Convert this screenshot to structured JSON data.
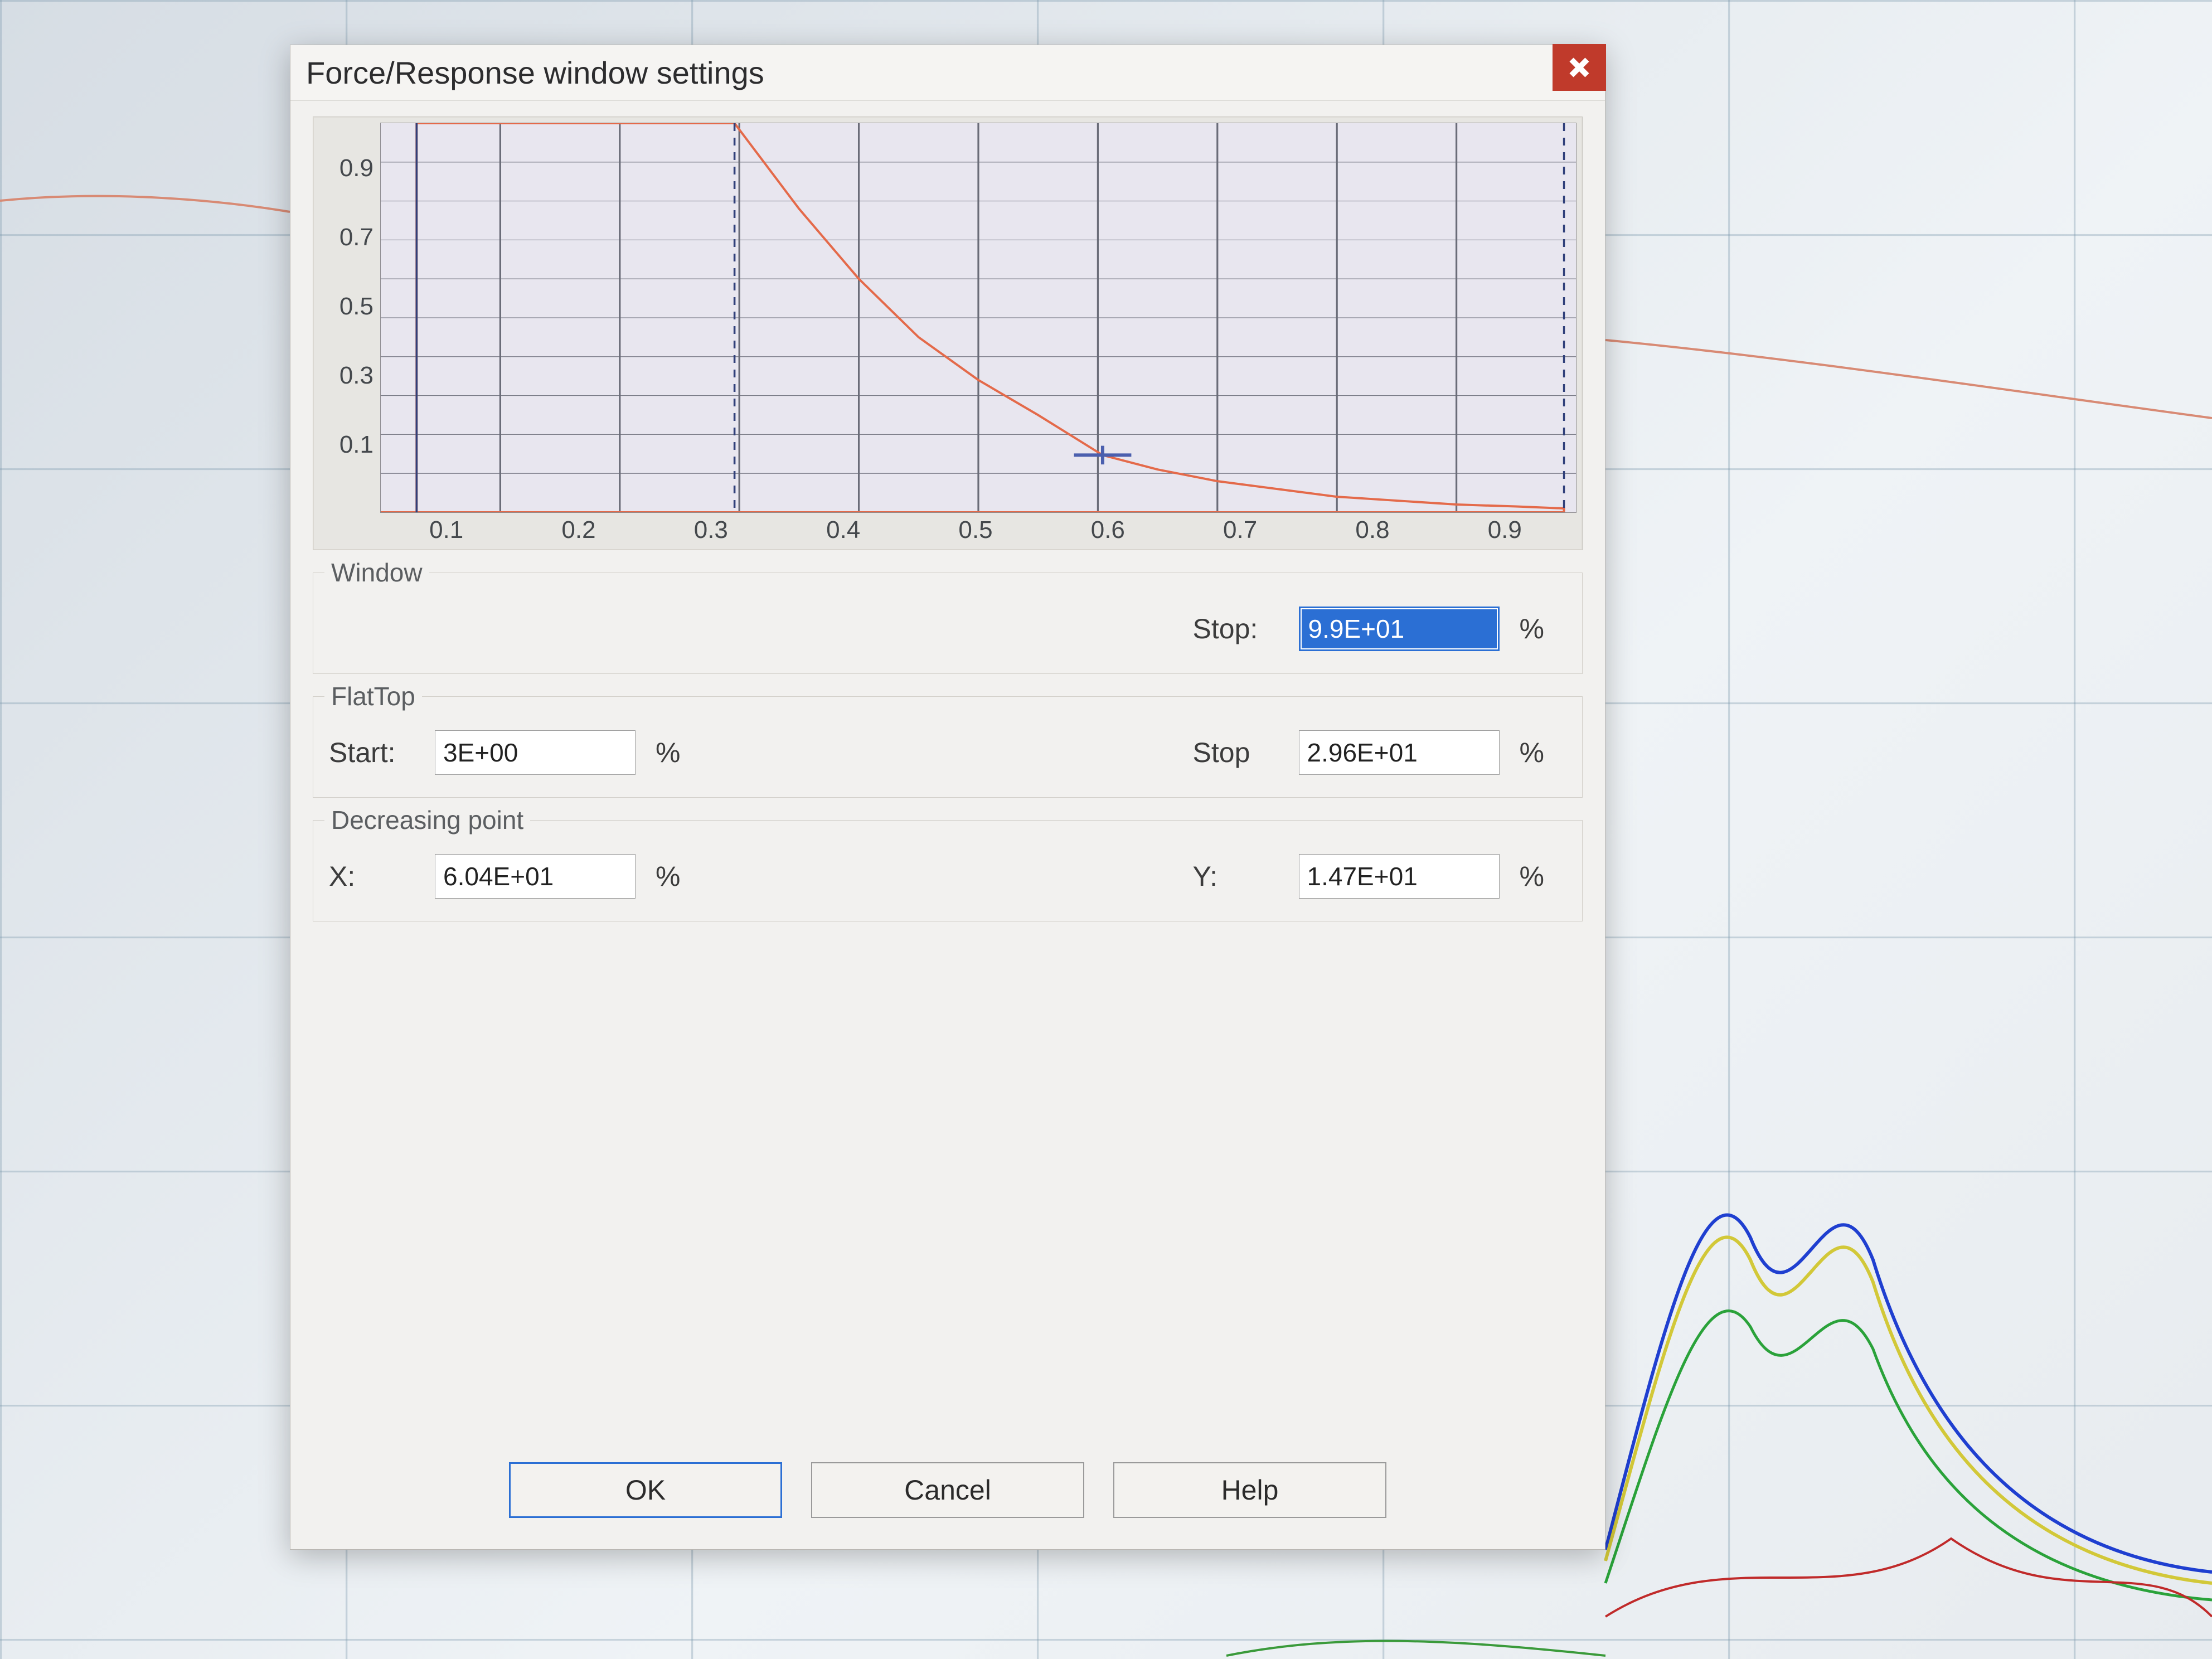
{
  "dialog": {
    "title": "Force/Response window settings",
    "close_icon": "close-icon"
  },
  "chart_data": {
    "type": "line",
    "title": "",
    "xlabel": "",
    "ylabel": "",
    "xlim": [
      0,
      1
    ],
    "ylim": [
      0,
      1
    ],
    "x_ticks": [
      "0.1",
      "0.2",
      "0.3",
      "0.4",
      "0.5",
      "0.6",
      "0.7",
      "0.8",
      "0.9"
    ],
    "y_ticks": [
      "0.9",
      "0.7",
      "0.5",
      "0.3",
      "0.1"
    ],
    "series": [
      {
        "name": "window-envelope",
        "color": "#e46a4a",
        "x": [
          0.0,
          0.03,
          0.03,
          0.296,
          0.35,
          0.4,
          0.45,
          0.5,
          0.55,
          0.604,
          0.65,
          0.7,
          0.75,
          0.8,
          0.85,
          0.9,
          0.95,
          0.99,
          0.99,
          0.0
        ],
        "y": [
          0.0,
          0.0,
          1.0,
          1.0,
          0.78,
          0.6,
          0.45,
          0.34,
          0.25,
          0.147,
          0.11,
          0.08,
          0.06,
          0.04,
          0.03,
          0.02,
          0.015,
          0.01,
          0.0,
          0.0
        ]
      }
    ],
    "markers": [
      {
        "name": "flattop-start-vline",
        "type": "vline",
        "x": 0.03,
        "style": "solid",
        "color": "#30407a"
      },
      {
        "name": "flattop-stop-vline",
        "type": "vline",
        "x": 0.296,
        "style": "dashed",
        "color": "#30407a"
      },
      {
        "name": "window-stop-vline",
        "type": "vline",
        "x": 0.99,
        "style": "dashed",
        "color": "#30407a"
      },
      {
        "name": "decreasing-point-cross",
        "type": "cross",
        "x": 0.604,
        "y": 0.147,
        "color": "#4b5fae"
      }
    ],
    "grid": true
  },
  "window": {
    "group_label": "Window",
    "stop_label": "Stop:",
    "stop_value": "9.9E+01",
    "stop_unit": "%"
  },
  "flattop": {
    "group_label": "FlatTop",
    "start_label": "Start:",
    "start_value": "3E+00",
    "start_unit": "%",
    "stop_label": "Stop",
    "stop_value": "2.96E+01",
    "stop_unit": "%"
  },
  "decreasing": {
    "group_label": "Decreasing point",
    "x_label": "X:",
    "x_value": "6.04E+01",
    "x_unit": "%",
    "y_label": "Y:",
    "y_value": "1.47E+01",
    "y_unit": "%"
  },
  "buttons": {
    "ok": "OK",
    "cancel": "Cancel",
    "help": "Help"
  }
}
